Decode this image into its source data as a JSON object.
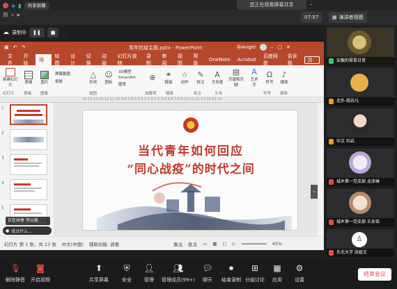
{
  "top": {
    "share_banner": "您正在观看屏幕共享",
    "view_label": "演讲者视图",
    "time": "07:57",
    "view_selector": "共享屏幕",
    "live_label": "录制中",
    "pause_icon": "❚❚",
    "stop_icon": "■"
  },
  "ppt": {
    "title": "青年抗疫主题.pptx - PowerPoint",
    "user": "孙Angel",
    "share_label": "共享",
    "tabs": [
      "文件",
      "开始",
      "插入",
      "绘图",
      "设计",
      "切换",
      "动画",
      "幻灯片放映",
      "录制",
      "审阅",
      "视图",
      "帮助",
      "OneNote",
      "Acrobat",
      "百度网盘",
      "告诉我"
    ],
    "ribbon_groups": [
      "幻灯片",
      "表格",
      "图像",
      "插图",
      "加载项",
      "链接",
      "批注",
      "文本",
      "符号",
      "媒体"
    ],
    "ribbon_items": [
      "新建幻灯片",
      "表格",
      "图片",
      "屏幕截图",
      "相册",
      "形状",
      "图标",
      "3D模型",
      "SmartArt",
      "图表",
      "链接",
      "动作",
      "批注",
      "文本框",
      "页眉和页脚",
      "艺术字",
      "符号",
      "媒体"
    ],
    "ruler": "16·15·14·13·12·11·10·9·8·7·6·5·4·3·2·1·0·1·2·3·4·5·6·7·8·9·10·11·12·13·14·15·16",
    "slide_numbers": [
      "1",
      "2",
      "3",
      "4",
      "5"
    ],
    "slide_title_line1": "当代青年如何回应",
    "slide_title_line2": "“同心战疫”的时代之间",
    "status_slide": "幻灯片 第 1 张，共 13 张",
    "status_lang": "中文(中国)",
    "status_access": "辅助功能: 调查",
    "status_notes": "备注",
    "status_comments": "批注",
    "zoom": "45%",
    "share_popup": "正在共享 可以拖",
    "bottom_caption": "说点什么..."
  },
  "participants": [
    {
      "name": "安徽的翠翠日常",
      "mic": "#2ecc71"
    },
    {
      "name": "北外-杨苏凡",
      "mic": "#f39c12"
    },
    {
      "name": "中文 石岩",
      "mic": "#f39c12"
    },
    {
      "name": "城乡第一党支部 龙泽琳",
      "mic": "#e74c3c"
    },
    {
      "name": "城乡第一党支部 王永铭",
      "mic": "#e74c3c"
    },
    {
      "name": "东北大学 张姐文",
      "mic": "#e74c3c"
    }
  ],
  "bottombar": {
    "items": [
      "解除静音",
      "开启视频",
      "共享屏幕",
      "安全",
      "管理",
      "管理成员(99+)",
      "聊天",
      "结束录制",
      "分组讨论",
      "应用",
      "设置"
    ],
    "end_label": "结束会议"
  },
  "colors": {
    "ppt_red": "#b7472a",
    "slide_title_red": "#c0392b",
    "end_red": "#e5484d"
  }
}
